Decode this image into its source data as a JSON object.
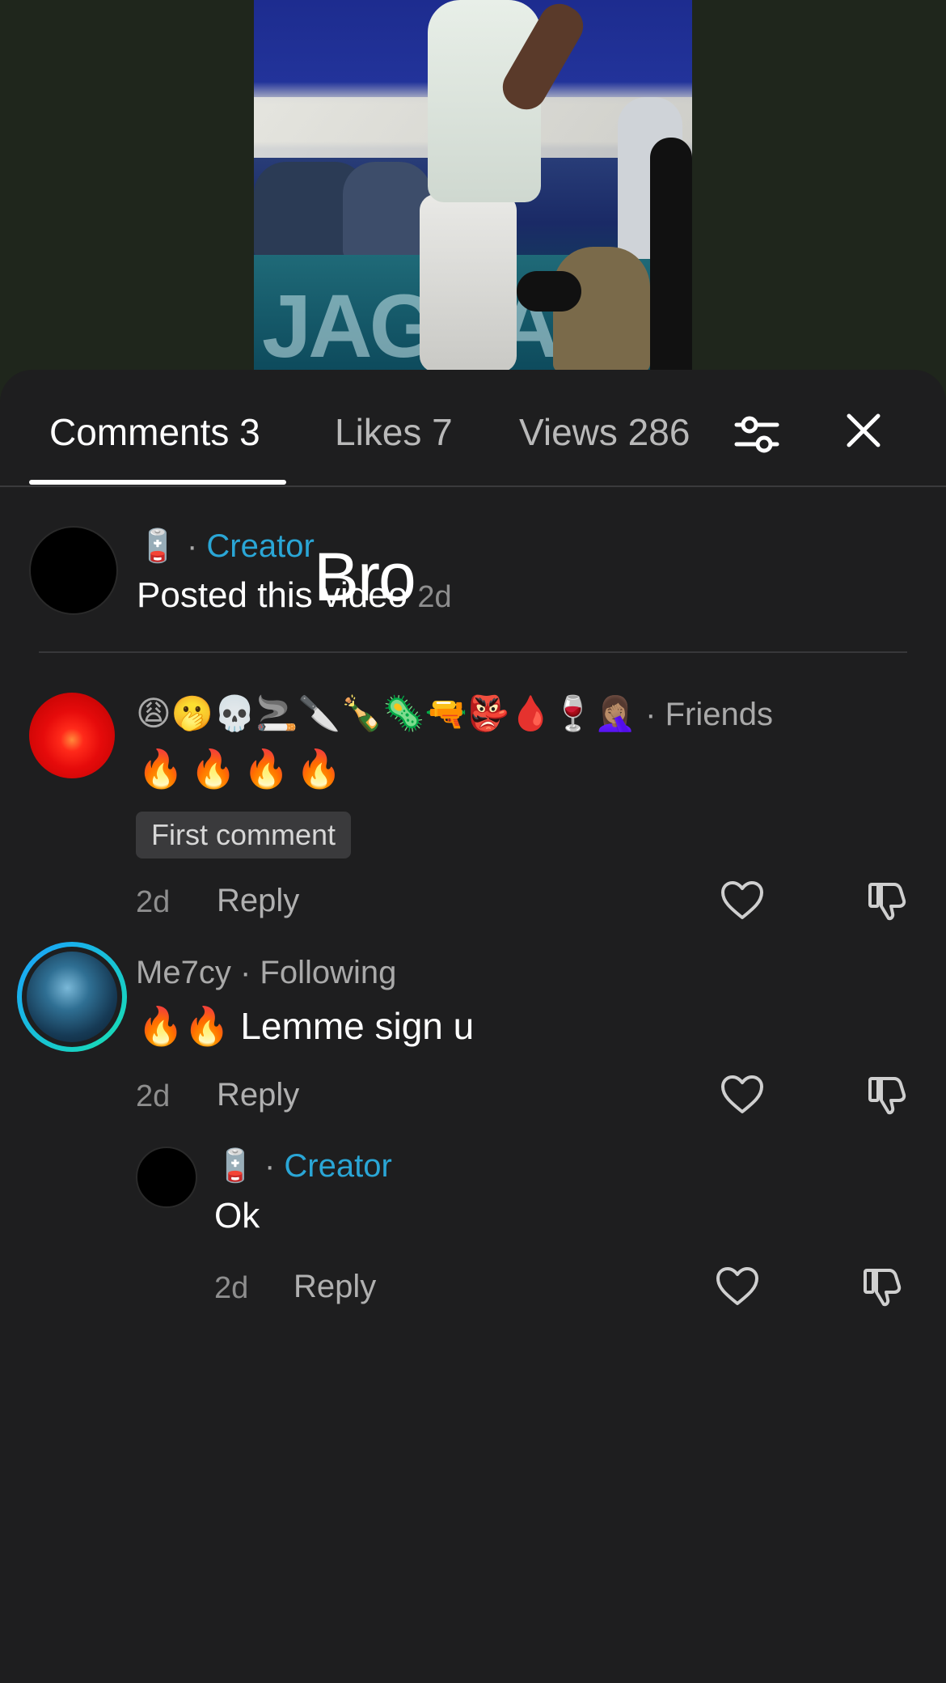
{
  "tabs": [
    {
      "label": "Comments 3"
    },
    {
      "label": "Likes 7"
    },
    {
      "label": "Views 286"
    }
  ],
  "video": {
    "wall_text": "JAGUA"
  },
  "overlay_text": "Bro",
  "post": {
    "author_emoji": "🪫",
    "separator": "·",
    "role": "Creator",
    "text": "Posted this video",
    "time": "2d"
  },
  "comments": [
    {
      "username": "😩🫢💀🚬🔪🍾🦠🔫👺🩸🍷🤦🏽‍♀️",
      "separator": "·",
      "relation": "Friends",
      "text": "🔥🔥🔥🔥",
      "badge": "First comment",
      "time": "2d",
      "reply_label": "Reply"
    },
    {
      "username": "Me7cy",
      "separator": "·",
      "relation": "Following",
      "text": "🔥🔥 Lemme sign u",
      "time": "2d",
      "reply_label": "Reply"
    }
  ],
  "reply": {
    "author_emoji": "🪫",
    "separator": "·",
    "role": "Creator",
    "text": "Ok",
    "time": "2d",
    "reply_label": "Reply"
  },
  "icons": {
    "filter": "sliders-icon",
    "close": "close-icon",
    "like": "heart-icon",
    "dislike": "thumbs-down-icon"
  },
  "colors": {
    "creator": "#2aa6d6",
    "sheet_bg": "#1e1e1f",
    "page_bg": "#1f261c"
  }
}
